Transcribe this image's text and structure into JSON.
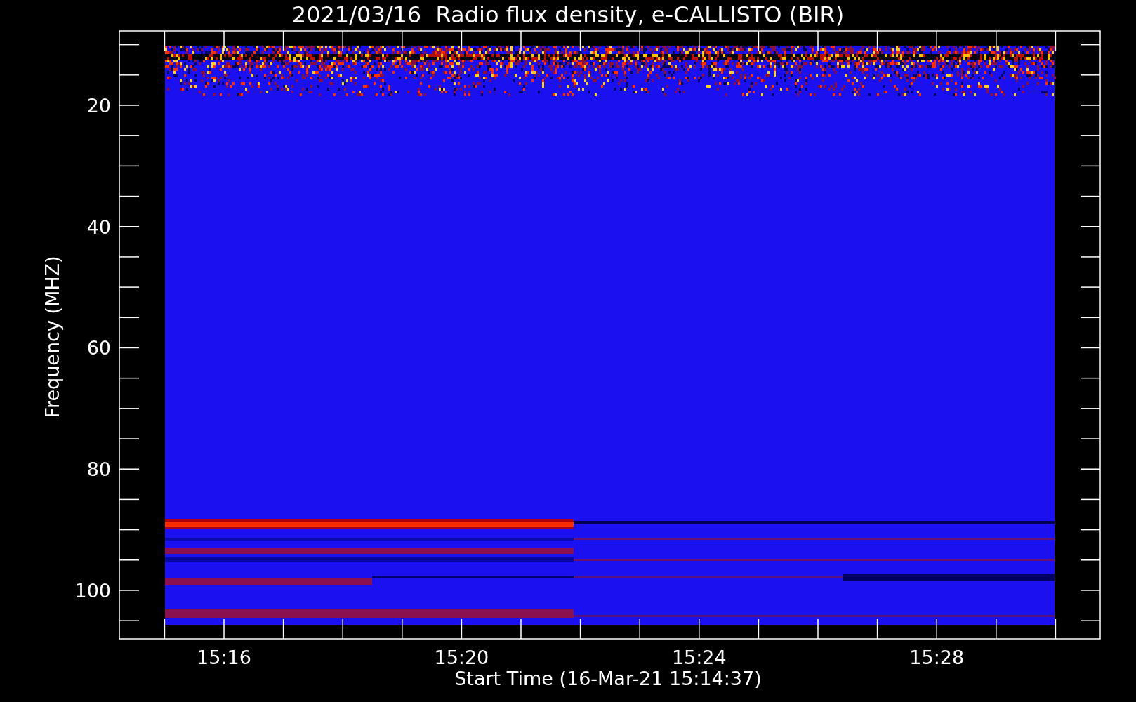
{
  "chart": {
    "title": "2021/03/16  Radio flux density, e-CALLISTO (BIR)",
    "xlabel": "Start Time (16-Mar-21 15:14:37)",
    "ylabel": "Frequency (MHZ)",
    "yticks": [
      "20",
      "40",
      "60",
      "80",
      "100"
    ],
    "xticks": [
      "15:16",
      "15:20",
      "15:24",
      "15:28"
    ]
  }
}
